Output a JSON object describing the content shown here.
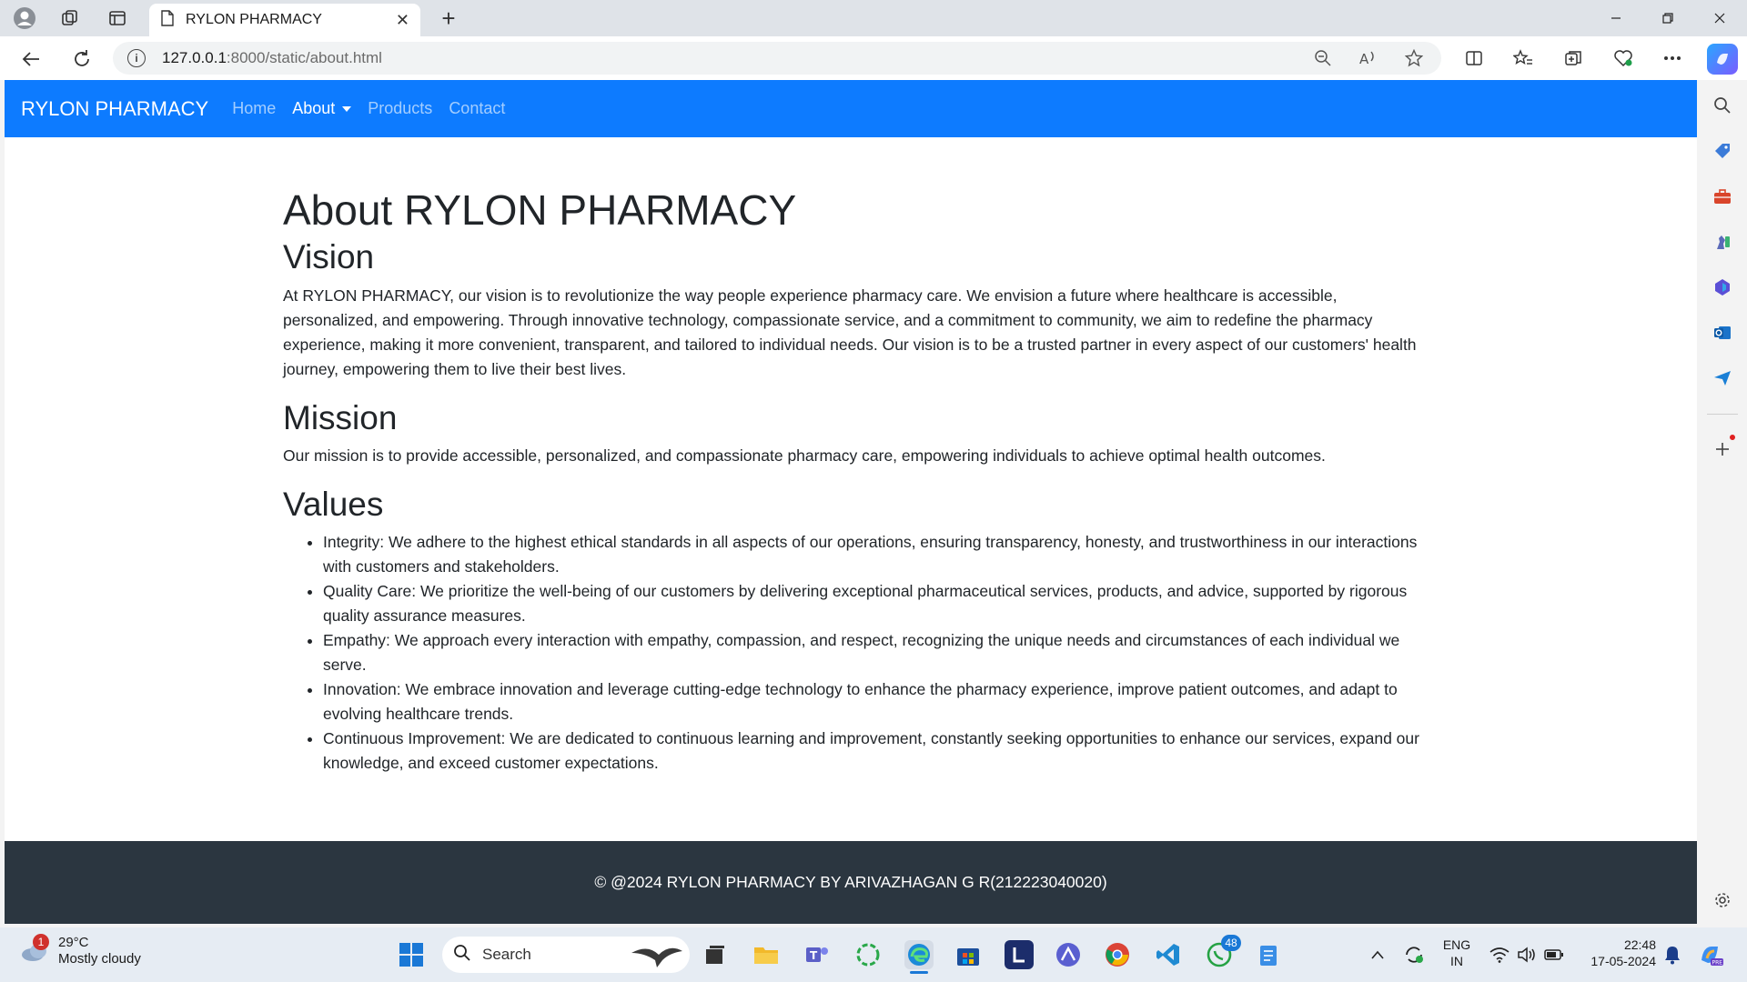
{
  "browser": {
    "tab_title": "RYLON PHARMACY",
    "tab_close": "✕",
    "new_tab": "+",
    "url_host": "127.0.0.1",
    "url_path": ":8000/static/about.html"
  },
  "navbar": {
    "brand": "RYLON PHARMACY",
    "links": [
      "Home",
      "About",
      "Products",
      "Contact"
    ]
  },
  "page": {
    "title": "About RYLON PHARMACY",
    "vision_heading": "Vision",
    "vision_text": "At RYLON PHARMACY, our vision is to revolutionize the way people experience pharmacy care. We envision a future where healthcare is accessible, personalized, and empowering. Through innovative technology, compassionate service, and a commitment to community, we aim to redefine the pharmacy experience, making it more convenient, transparent, and tailored to individual needs. Our vision is to be a trusted partner in every aspect of our customers' health journey, empowering them to live their best lives.",
    "mission_heading": "Mission",
    "mission_text": "Our mission is to provide accessible, personalized, and compassionate pharmacy care, empowering individuals to achieve optimal health outcomes.",
    "values_heading": "Values",
    "values": [
      "Integrity: We adhere to the highest ethical standards in all aspects of our operations, ensuring transparency, honesty, and trustworthiness in our interactions with customers and stakeholders.",
      "Quality Care: We prioritize the well-being of our customers by delivering exceptional pharmaceutical services, products, and advice, supported by rigorous quality assurance measures.",
      "Empathy: We approach every interaction with empathy, compassion, and respect, recognizing the unique needs and circumstances of each individual we serve.",
      "Innovation: We embrace innovation and leverage cutting-edge technology to enhance the pharmacy experience, improve patient outcomes, and adapt to evolving healthcare trends.",
      "Continuous Improvement: We are dedicated to continuous learning and improvement, constantly seeking opportunities to enhance our services, expand our knowledge, and exceed customer expectations."
    ],
    "footer": "© @2024 RYLON PHARMACY BY ARIVAZHAGAN G R(212223040020)"
  },
  "taskbar": {
    "weather_temp": "29°C",
    "weather_desc": "Mostly cloudy",
    "weather_badge": "1",
    "search_label": "Search",
    "whatsapp_badge": "48",
    "lang_top": "ENG",
    "lang_bottom": "IN",
    "time": "22:48",
    "date": "17-05-2024"
  },
  "colors": {
    "navbar_bg": "#0d7bff",
    "footer_bg": "#2b3640"
  }
}
